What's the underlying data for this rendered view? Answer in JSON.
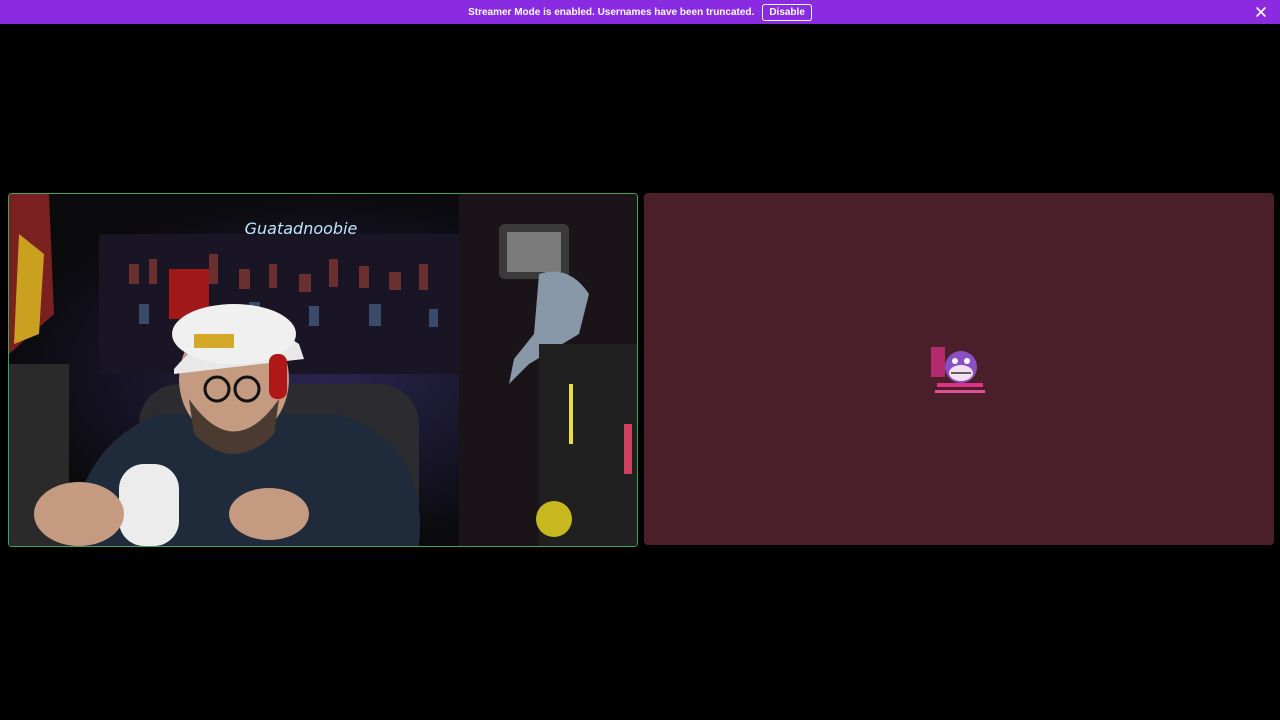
{
  "banner": {
    "message": "Streamer Mode is enabled. Usernames have been truncated.",
    "disable_label": "Disable",
    "close_icon": "close-icon",
    "color": "#8a2be2"
  },
  "call": {
    "participants": [
      {
        "type": "video",
        "speaking": true,
        "border_color": "#3ba55d",
        "neon_sign": "Guatadnoobie"
      },
      {
        "type": "avatar",
        "background_color": "#4b1f2a"
      }
    ]
  }
}
